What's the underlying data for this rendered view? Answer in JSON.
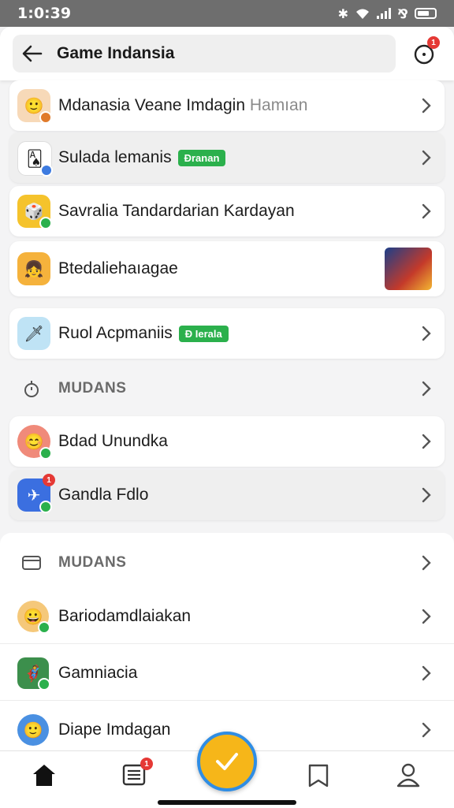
{
  "status_bar": {
    "time": "1:0:39"
  },
  "header": {
    "title": "Game Indansia",
    "notification_count": "1"
  },
  "cards": [
    {
      "label": "Mdanasia Veane  Imdagin",
      "suffix": "Hamıan",
      "icon": "avatar-boy-icon",
      "icon_bg": "#f7d9b8",
      "dot": "#e07a2b"
    },
    {
      "label": "Sulada lemanis",
      "tag": "Đranan",
      "tag_style": "outline",
      "icon": "game-card-icon",
      "icon_bg": "#ffffff",
      "dot": "#3d7be0"
    },
    {
      "label": "Savralia Tandardarian Kardayan",
      "icon": "game-box-icon",
      "icon_bg": "#f5c32c",
      "dot": "#2bb04c"
    },
    {
      "label": "Btedaliehaıagae",
      "icon": "avatar-girl-icon",
      "icon_bg": "#f5b23c"
    },
    {
      "label": "Ruol Acpmaniis",
      "tag": "Ð Ierala",
      "tag_style": "solid",
      "icon": "sword-icon",
      "icon_bg": "#bfe3f5"
    }
  ],
  "sections": [
    {
      "title": "MUDANS",
      "icon": "timer-icon"
    },
    {
      "title": "MUDANS",
      "icon": "folder-icon"
    }
  ],
  "group_items": [
    {
      "label": "Bdad Unundka",
      "icon": "avatar-kid-icon",
      "icon_bg": "#f08a7a",
      "dot": "#2bb04c"
    },
    {
      "label": "Gandla Fdlo",
      "icon": "maps-app-icon",
      "icon_bg": "#3b6fe0",
      "dot": "#2bb04c",
      "badge": "1"
    }
  ],
  "list_rows": [
    {
      "label": "Bariodamdlaiakan",
      "icon": "avatar-smile-icon",
      "icon_bg": "#f5c87a",
      "dot": "#2bb04c"
    },
    {
      "label": "Gamniacia",
      "icon": "game-hero-icon",
      "icon_bg": "#3c8f4c",
      "dot": "#2bb04c"
    },
    {
      "label": "Diape Imdagan",
      "icon": "avatar-blue-icon",
      "icon_bg": "#4a90e2"
    }
  ],
  "nav": {
    "list_badge": "1"
  },
  "colors": {
    "accent_green": "#2bb04c",
    "fab_fill": "#f6b619",
    "fab_ring": "#2f8de4",
    "badge_red": "#e53935"
  }
}
